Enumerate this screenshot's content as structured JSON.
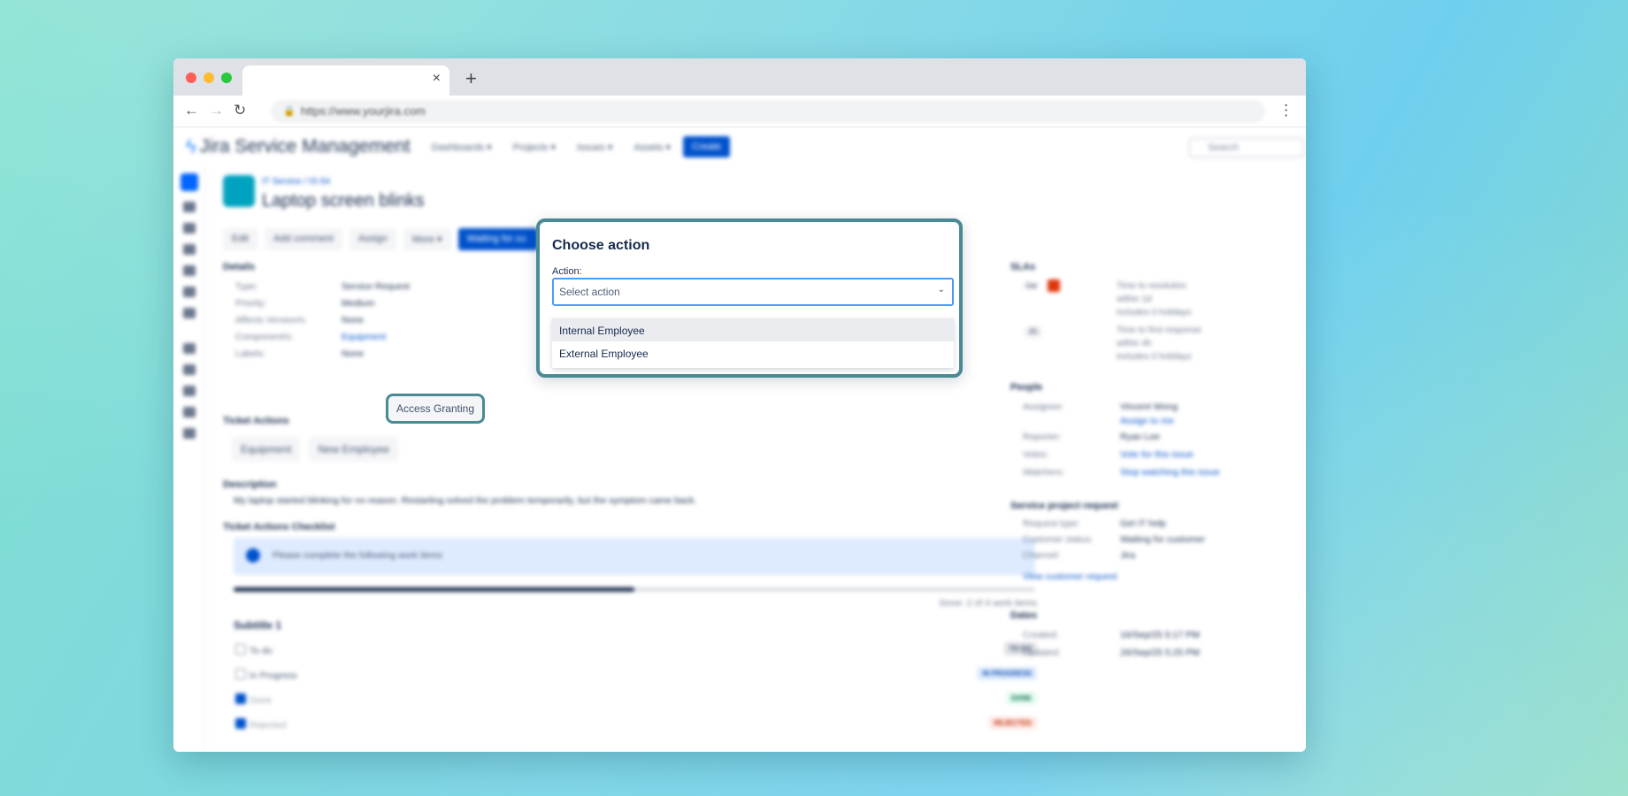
{
  "browser": {
    "url": "https://www.yourjira.com",
    "new_tab": "+",
    "close_tab": "×"
  },
  "app": {
    "brand": "Jira Service Management",
    "nav": [
      "Dashboards ▾",
      "Projects ▾",
      "Issues ▾",
      "Assets ▾"
    ],
    "create": "Create",
    "search_placeholder": "Search"
  },
  "issue": {
    "breadcrumb": "IT Service / IS-54",
    "title": "Laptop screen blinks",
    "toolbar": [
      "Edit",
      "Add comment",
      "Assign",
      "More ▾",
      "Waiting for cu"
    ],
    "details_heading": "Details",
    "details": [
      {
        "k": "Type:",
        "v": "Service Request"
      },
      {
        "k": "Priority:",
        "v": "Medium"
      },
      {
        "k": "Affects Version/s:",
        "v": "None"
      },
      {
        "k": "Component/s:",
        "v": "Equipment"
      },
      {
        "k": "Labels:",
        "v": "None"
      }
    ],
    "ticket_actions_heading": "Ticket Actions",
    "ticket_actions": [
      "Equipment",
      "New Employee",
      "Access Granting"
    ],
    "description_heading": "Description",
    "description": "My laptop started blinking for no reason. Restarting solved the problem temporarily, but the symptom came back.",
    "checklist_heading": "Ticket Actions Checklist",
    "checklist_info": "Please complete the following work items",
    "checklist_progress": 0.5,
    "checklist_done": "Done: 2 of 4 work items",
    "subtitle": "Subtitle 1",
    "items": [
      {
        "label": "To do",
        "status": "TO DO"
      },
      {
        "label": "In Progress",
        "status": "IN PROGRESS"
      },
      {
        "label": "Done",
        "status": "DONE"
      },
      {
        "label": "Rejected",
        "status": "REJECTED"
      }
    ]
  },
  "sidebar_right": {
    "slas_heading": "SLAs",
    "sla1_badge": "-1w",
    "sla1": [
      "Time to resolution",
      "within 1d",
      "includes 0 holidays"
    ],
    "sla2_badge": "4h",
    "sla2": [
      "Time to first response",
      "within 4h",
      "includes 0 holidays"
    ],
    "people_heading": "People",
    "assignee_k": "Assignee:",
    "assignee_v": "Vincent Wong",
    "assign_to_me": "Assign to me",
    "reporter_k": "Reporter:",
    "reporter_v": "Ryan Lee",
    "votes_k": "Votes:",
    "votes_v": "Vote for this issue",
    "watchers_k": "Watchers:",
    "watchers_v": "Stop watching this issue",
    "spr_heading": "Service project request",
    "req_type_k": "Request type:",
    "req_type_v": "Get IT help",
    "cust_status_k": "Customer status:",
    "cust_status_v": "Waiting for customer",
    "channel_k": "Channel:",
    "channel_v": "Jira",
    "view_request": "View customer request",
    "dates_heading": "Dates",
    "created_k": "Created:",
    "created_v": "16/Sep/25 5:17 PM",
    "updated_k": "Updated:",
    "updated_v": "26/Sep/25 5:25 PM"
  },
  "modal": {
    "title": "Choose action",
    "label": "Action:",
    "placeholder": "Select action",
    "options": [
      "Internal Employee",
      "External Employee"
    ]
  }
}
